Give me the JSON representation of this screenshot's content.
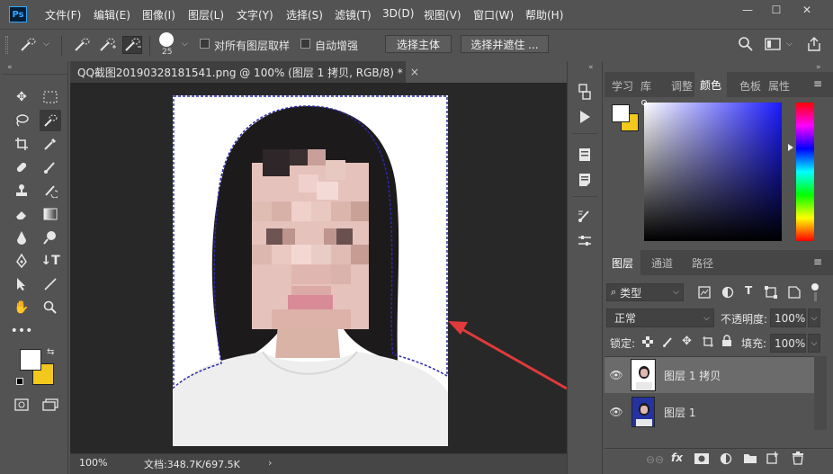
{
  "app": {
    "logo": "Ps"
  },
  "menu": [
    "文件(F)",
    "编辑(E)",
    "图像(I)",
    "图层(L)",
    "文字(Y)",
    "选择(S)",
    "滤镜(T)",
    "3D(D)",
    "视图(V)",
    "窗口(W)",
    "帮助(H)"
  ],
  "window_controls": {
    "minimize": "—",
    "maximize": "☐",
    "close": "✕"
  },
  "options": {
    "brush_size": "25",
    "sample_all_layers": "对所有图层取样",
    "auto_enhance": "自动增强",
    "select_subject": "选择主体",
    "select_and_mask": "选择并遮住 ..."
  },
  "document": {
    "tab_title": "QQ截图20190328181541.png @ 100% (图层 1 拷贝, RGB/8) *",
    "close_symbol": "×",
    "zoom": "100%",
    "doc_info": "文档:348.7K/697.5K"
  },
  "panels": {
    "top_tabs": [
      "学习",
      "库",
      "调整",
      "颜色",
      "色板",
      "属性"
    ],
    "top_active": "颜色",
    "layer_tabs": [
      "图层",
      "通道",
      "路径"
    ],
    "layer_active": "图层",
    "filter_kind": "类型",
    "blend_mode": "正常",
    "opacity_label": "不透明度:",
    "opacity_value": "100%",
    "lock_label": "锁定:",
    "fill_label": "填充:",
    "fill_value": "100%"
  },
  "layers": [
    {
      "name": "图层 1 拷贝",
      "selected": true
    },
    {
      "name": "图层 1",
      "selected": false
    }
  ],
  "colors": {
    "foreground": "#ffffff",
    "background": "#f2c81d",
    "accent_arrow": "#e03a3a",
    "selection_edge": "#2a2aa8"
  }
}
